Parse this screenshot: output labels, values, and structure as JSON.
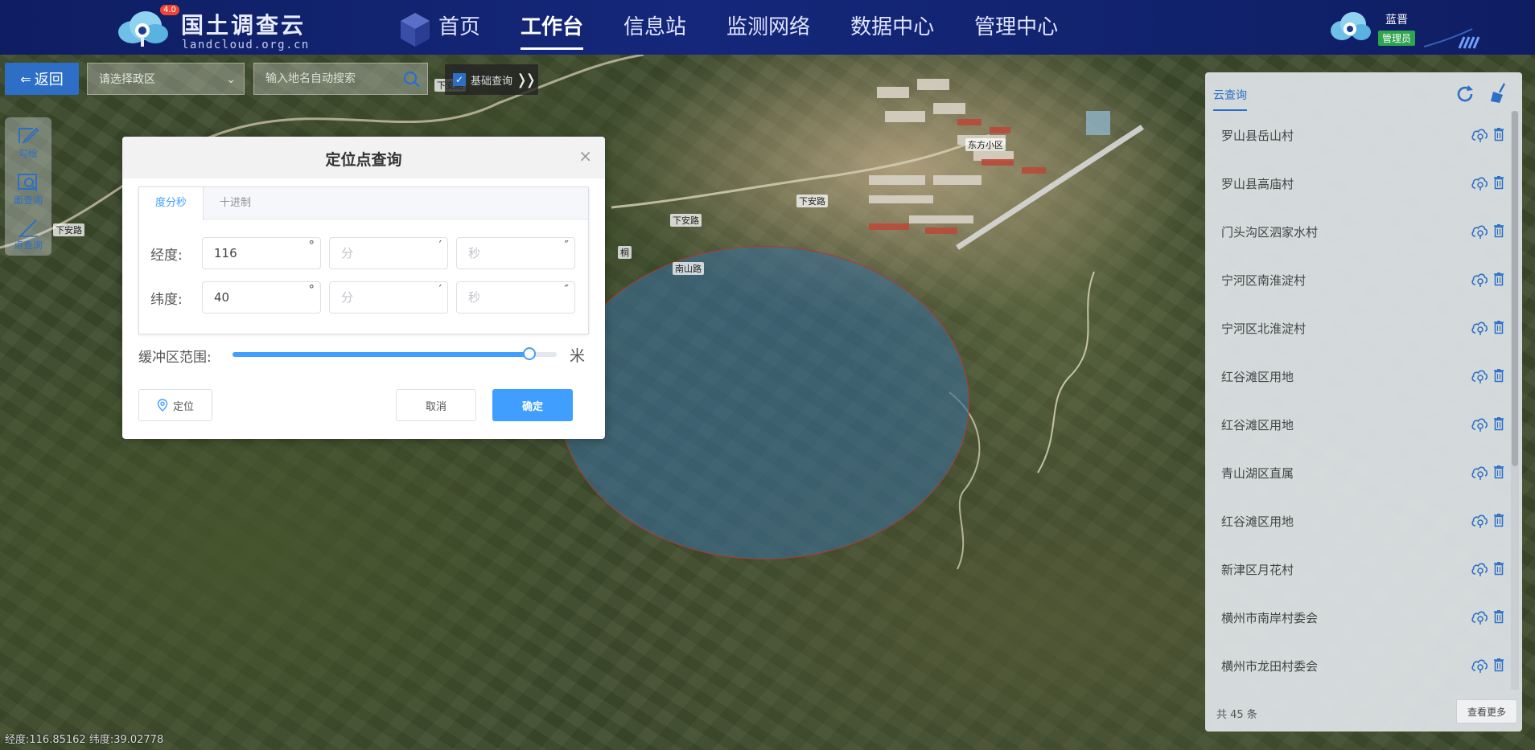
{
  "header": {
    "logo_title": "国土调查云",
    "logo_sub": "landcloud.org.cn",
    "logo_badge": "4.0",
    "nav": [
      "首页",
      "工作台",
      "信息站",
      "监测网络",
      "数据中心",
      "管理中心"
    ],
    "active_nav": "工作台",
    "user_name": "蓝晋",
    "user_role": "管理员"
  },
  "toolbar": {
    "back_label": "返回",
    "region_placeholder": "请选择政区",
    "search_placeholder": "输入地名自动搜索",
    "basic_query_label": "基础查询",
    "basic_query_checked": true
  },
  "left_tools": [
    {
      "label": "勾绘",
      "icon": "draw-icon"
    },
    {
      "label": "面查询",
      "icon": "area-query-icon"
    },
    {
      "label": "点查询",
      "icon": "point-query-icon"
    }
  ],
  "map": {
    "labels": [
      "下安路",
      "下安路",
      "下安路",
      "下安路",
      "东方小区",
      "南山路",
      "桐"
    ],
    "buffer_fill": "#3c6e96",
    "buffer_stroke": "#b0392d"
  },
  "dialog": {
    "title": "定位点查询",
    "tabs": [
      "度分秒",
      "十进制"
    ],
    "active_tab": "度分秒",
    "longitude": {
      "label": "经度:",
      "deg": "116",
      "min": "",
      "sec": "",
      "min_placeholder": "分",
      "sec_placeholder": "秒"
    },
    "latitude": {
      "label": "纬度:",
      "deg": "40",
      "min": "",
      "sec": "",
      "min_placeholder": "分",
      "sec_placeholder": "秒"
    },
    "units": {
      "deg": "°",
      "min": "′",
      "sec": "″"
    },
    "buffer_label": "缓冲区范围:",
    "buffer_unit": "米",
    "buffer_fraction": 0.915,
    "locate_label": "定位",
    "cancel_label": "取消",
    "ok_label": "确定"
  },
  "right_panel": {
    "tab_label": "云查询",
    "items": [
      "罗山县岳山村",
      "罗山县高庙村",
      "门头沟区泗家水村",
      "宁河区南淮淀村",
      "宁河区北淮淀村",
      "红谷滩区用地",
      "红谷滩区用地",
      "青山湖区直属",
      "红谷滩区用地",
      "新津区月花村",
      "横州市南岸村委会",
      "横州市龙田村委会"
    ],
    "total_label": "共 45 条",
    "more_label": "查看更多"
  },
  "status": {
    "text": "经度:116.85162  纬度:39.02778"
  }
}
